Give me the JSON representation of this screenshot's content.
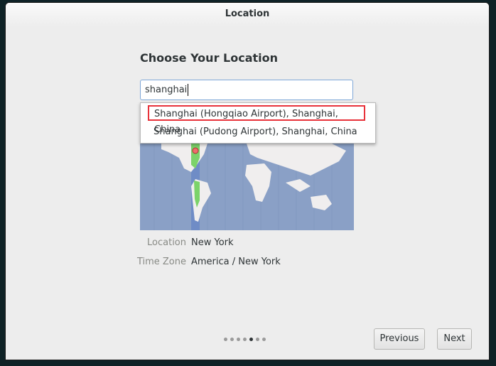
{
  "window": {
    "title": "Location"
  },
  "page": {
    "heading": "Choose Your Location"
  },
  "search": {
    "value": "shanghai"
  },
  "suggestions": [
    {
      "label": "Shanghai (Hongqiao Airport), Shanghai, China",
      "highlighted": true
    },
    {
      "label": "Shanghai (Pudong Airport), Shanghai, China",
      "highlighted": false
    }
  ],
  "map": {
    "marker_icon": "location-pin-icon",
    "ocean_color": "#8aa0c6",
    "timezone_highlight_color": "#7bd36a"
  },
  "info": {
    "location_label": "Location",
    "location_value": "New York",
    "timezone_label": "Time Zone",
    "timezone_value": "America / New York"
  },
  "pagination": {
    "total": 7,
    "current": 5
  },
  "buttons": {
    "previous": "Previous",
    "next": "Next"
  },
  "colors": {
    "highlight_border": "#e8323a",
    "focus_border": "#7ea7d8"
  }
}
